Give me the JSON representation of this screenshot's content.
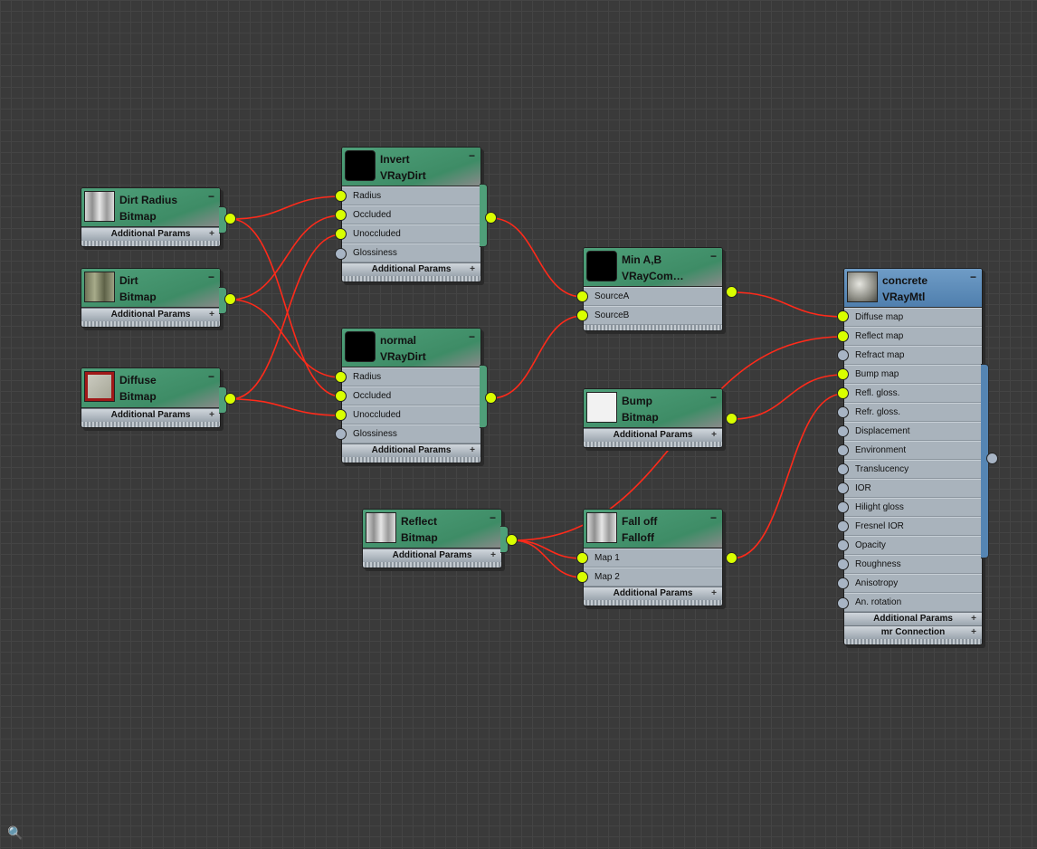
{
  "footer_labels": {
    "additional_params": "Additional Params",
    "mr_connection": "mr Connection",
    "plus": "+",
    "collapse": "−"
  },
  "nodes": {
    "dirt_radius": {
      "name": "Dirt Radius",
      "type": "Bitmap",
      "thumb": "bitmap-concrete"
    },
    "dirt": {
      "name": "Dirt",
      "type": "Bitmap",
      "thumb": "bitmap-dirt"
    },
    "diffuse": {
      "name": "Diffuse",
      "type": "Bitmap",
      "thumb": "bitmap-diffuse"
    },
    "invert": {
      "name": "Invert",
      "type": "VRayDirt",
      "slots": [
        "Radius",
        "Occluded",
        "Unoccluded",
        "Glossiness"
      ]
    },
    "normal": {
      "name": "normal",
      "type": "VRayDirt",
      "slots": [
        "Radius",
        "Occluded",
        "Unoccluded",
        "Glossiness"
      ]
    },
    "min_ab": {
      "name": "Min A,B",
      "type": "VRayCom…",
      "slots": [
        "SourceA",
        "SourceB"
      ]
    },
    "bump": {
      "name": "Bump",
      "type": "Bitmap",
      "thumb": "bitmap-white"
    },
    "reflect": {
      "name": "Reflect",
      "type": "Bitmap",
      "thumb": "bitmap-concrete"
    },
    "falloff": {
      "name": "Fall off",
      "type": "Falloff",
      "slots": [
        "Map 1",
        "Map 2"
      ]
    },
    "concrete": {
      "name": "concrete",
      "type": "VRayMtl",
      "slots": [
        "Diffuse map",
        "Reflect map",
        "Refract map",
        "Bump map",
        "Refl. gloss.",
        "Refr. gloss.",
        "Displacement",
        "Environment",
        "Translucency",
        "IOR",
        "Hilight gloss",
        "Fresnel IOR",
        "Opacity",
        "Roughness",
        "Anisotropy",
        "An. rotation"
      ],
      "connected_slots": [
        "Diffuse map",
        "Reflect map",
        "Bump map",
        "Refl. gloss."
      ]
    }
  },
  "connections": [
    {
      "from": "Dirt Radius",
      "to": "Invert.Radius"
    },
    {
      "from": "Dirt Radius",
      "to": "normal.Occluded"
    },
    {
      "from": "Dirt",
      "to": "Invert.Occluded"
    },
    {
      "from": "Dirt",
      "to": "normal.Radius"
    },
    {
      "from": "Diffuse",
      "to": "Invert.Unoccluded"
    },
    {
      "from": "Diffuse",
      "to": "normal.Unoccluded"
    },
    {
      "from": "Invert",
      "to": "Min A,B.SourceA"
    },
    {
      "from": "normal",
      "to": "Min A,B.SourceB"
    },
    {
      "from": "Min A,B",
      "to": "concrete.Diffuse map"
    },
    {
      "from": "Reflect",
      "to": "concrete.Reflect map"
    },
    {
      "from": "Reflect",
      "to": "Fall off.Map 1"
    },
    {
      "from": "Reflect",
      "to": "Fall off.Map 2"
    },
    {
      "from": "Bump",
      "to": "concrete.Bump map"
    },
    {
      "from": "Fall off",
      "to": "concrete.Refl. gloss."
    }
  ],
  "colors": {
    "background": "#3a3a3a",
    "node_header_green": "#4fa07a",
    "node_header_blue": "#5f8fbe",
    "node_body": "#a9b3bc",
    "wire": "#ff2a1a",
    "socket_connected": "#d9ff00",
    "socket_empty": "#a7b4c4"
  },
  "nav_icon": "binoculars-icon"
}
